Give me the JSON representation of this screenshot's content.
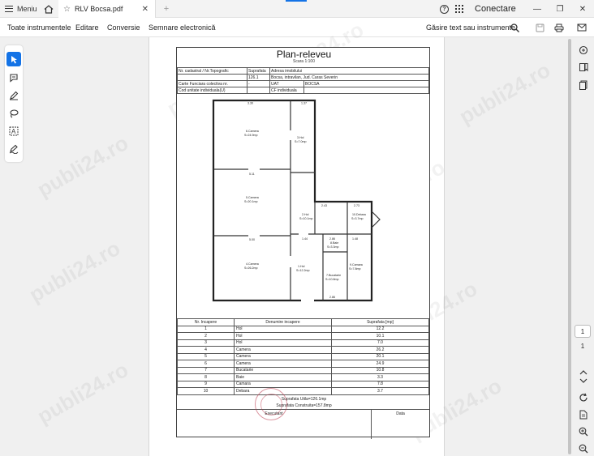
{
  "titlebar": {
    "menu_label": "Meniu",
    "tab_title": "RLV Bocsa.pdf",
    "sign_in": "Conectare"
  },
  "toolbar": {
    "links": [
      "Toate instrumentele",
      "Editare",
      "Conversie",
      "Semnare electronică"
    ],
    "search_label": "Găsire text sau instrumente"
  },
  "pagination": {
    "current": "1",
    "total": "1"
  },
  "document": {
    "title": "Plan-releveu",
    "scale": "Scara 1:100",
    "header_rows": [
      [
        "Nr. cadastral / Nr.Topografic",
        "Suprafata",
        "Adresa imobilului"
      ],
      [
        "",
        "126.1",
        "Bocsa, intravilan, Jud. Caras Severin"
      ],
      [
        "Carte Funciara colectiva nr.",
        "-",
        "UAT",
        "BOCSA"
      ],
      [
        "Cod unitate individuala(U)",
        "",
        "CF individuala",
        ""
      ]
    ],
    "plan": {
      "dims": [
        "3.30",
        "1.37",
        "5.11",
        "2.43",
        "2.73",
        "5.00",
        "1.44",
        "2.86",
        "1.48",
        "2.86"
      ],
      "labels": [
        [
          "6.Camera",
          "S=24.9mp"
        ],
        [
          "3.Hol",
          "S=7.0mp"
        ],
        [
          "5.Camera",
          "S=20.1mp"
        ],
        [
          "2.Hol",
          "S=10.1mp"
        ],
        [
          "10.Debara",
          "S=3.7mp"
        ],
        [
          "4.Camera",
          "S=26.2mp"
        ],
        [
          "8.Baie",
          "S=3.3mp"
        ],
        [
          "1.Hol",
          "S=12.2mp"
        ],
        [
          "7.Bucatarie",
          "S=10.8mp"
        ],
        [
          "9.Camara",
          "S=7.8mp"
        ]
      ]
    },
    "rooms_header": [
      "Nr. Incapere",
      "Denumire incapere",
      "Suprafata [mp]"
    ],
    "rooms": [
      [
        "1",
        "Hol",
        "12.2"
      ],
      [
        "2",
        "Hol",
        "10.1"
      ],
      [
        "3",
        "Hol",
        "7.0"
      ],
      [
        "4",
        "Camera",
        "26.2"
      ],
      [
        "5",
        "Camera",
        "20.1"
      ],
      [
        "6",
        "Camera",
        "24.9"
      ],
      [
        "7",
        "Bucatarie",
        "10.8"
      ],
      [
        "8",
        "Baie",
        "3.3"
      ],
      [
        "9",
        "Camara",
        "7.8"
      ],
      [
        "10",
        "Debara",
        "3.7"
      ]
    ],
    "surface_useful": "Suprafata Utila=126.1mp",
    "surface_built": "Suprafata Construita=157.8mp",
    "executant": "Executant",
    "date": "Data"
  },
  "watermark": "publi24.ro",
  "colors": {
    "accent": "#1473e6",
    "stamp": "#be3c50"
  },
  "icons": {
    "titlebar": [
      "menu-icon",
      "home-icon",
      "star-icon",
      "close-icon",
      "add-tab-icon",
      "help-icon",
      "apps-grid-icon",
      "minimize-icon",
      "restore-icon",
      "close-window-icon"
    ],
    "toolbar": [
      "search-icon",
      "save-icon",
      "print-icon",
      "email-icon"
    ],
    "left_rail": [
      "select-arrow-icon",
      "comment-add-icon",
      "pen-icon",
      "lasso-icon",
      "text-box-icon",
      "signature-icon"
    ],
    "right_rail": [
      "comments-icon",
      "bookmark-icon",
      "pages-icon",
      "chevron-up-icon",
      "chevron-down-icon",
      "rotate-icon",
      "document-info-icon",
      "zoom-in-icon",
      "zoom-out-icon"
    ]
  }
}
